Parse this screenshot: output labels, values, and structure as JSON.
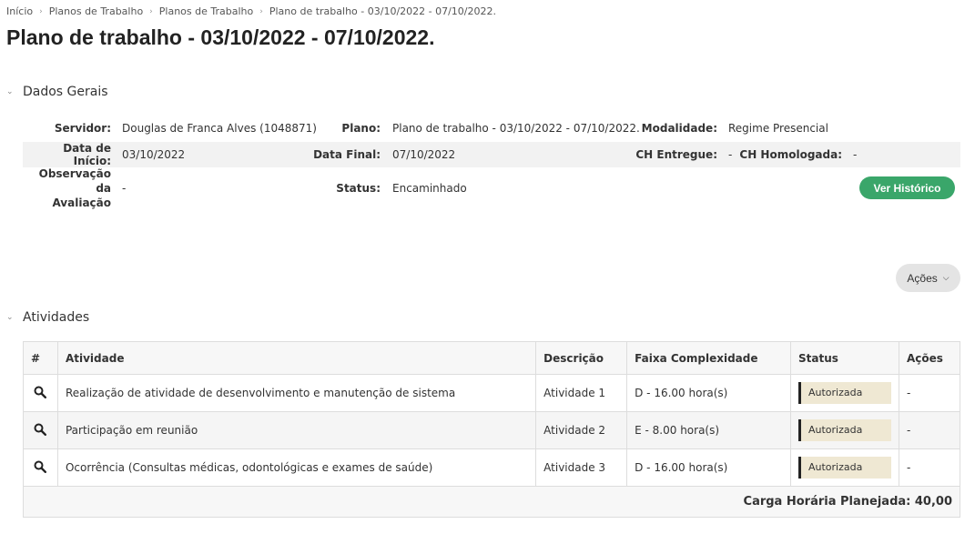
{
  "breadcrumb": [
    "Início",
    "Planos de Trabalho",
    "Planos de Trabalho",
    "Plano de trabalho - 03/10/2022 - 07/10/2022."
  ],
  "title": "Plano de trabalho - 03/10/2022 - 07/10/2022.",
  "dados_gerais": {
    "heading": "Dados Gerais",
    "servidor_label": "Servidor:",
    "servidor": "Douglas de Franca Alves (1048871)",
    "plano_label": "Plano:",
    "plano": "Plano de trabalho - 03/10/2022 - 07/10/2022.",
    "modalidade_label": "Modalidade:",
    "modalidade": "Regime Presencial",
    "data_inicio_label": "Data de Início:",
    "data_inicio": "03/10/2022",
    "data_final_label": "Data Final:",
    "data_final": "07/10/2022",
    "ch_entregue_label": "CH Entregue:",
    "ch_entregue": "-",
    "ch_homologada_label": "CH Homologada:",
    "ch_homologada": "-",
    "obs_label_1": "Observação da",
    "obs_label_2": "Avaliação",
    "obs": "-",
    "status_label": "Status:",
    "status": "Encaminhado",
    "historico_button": "Ver Histórico"
  },
  "acoes_button": "Ações",
  "atividades": {
    "heading": "Atividades",
    "columns": [
      "#",
      "Atividade",
      "Descrição",
      "Faixa Complexidade",
      "Status",
      "Ações"
    ],
    "rows": [
      {
        "atividade": "Realização de atividade de desenvolvimento e manutenção de sistema",
        "descricao": "Atividade 1",
        "faixa": "D - 16.00 hora(s)",
        "status": "Autorizada",
        "acoes": "-"
      },
      {
        "atividade": "Participação em reunião",
        "descricao": "Atividade 2",
        "faixa": "E - 8.00 hora(s)",
        "status": "Autorizada",
        "acoes": "-"
      },
      {
        "atividade": "Ocorrência (Consultas médicas, odontológicas e exames de saúde)",
        "descricao": "Atividade 3",
        "faixa": "D - 16.00 hora(s)",
        "status": "Autorizada",
        "acoes": "-"
      }
    ],
    "footer": "Carga Horária Planejada: 40,00"
  },
  "icons": {
    "row_action": "search-icon",
    "section_toggle": "chevron-down-icon",
    "breadcrumb_sep": "chevron-right-icon"
  }
}
